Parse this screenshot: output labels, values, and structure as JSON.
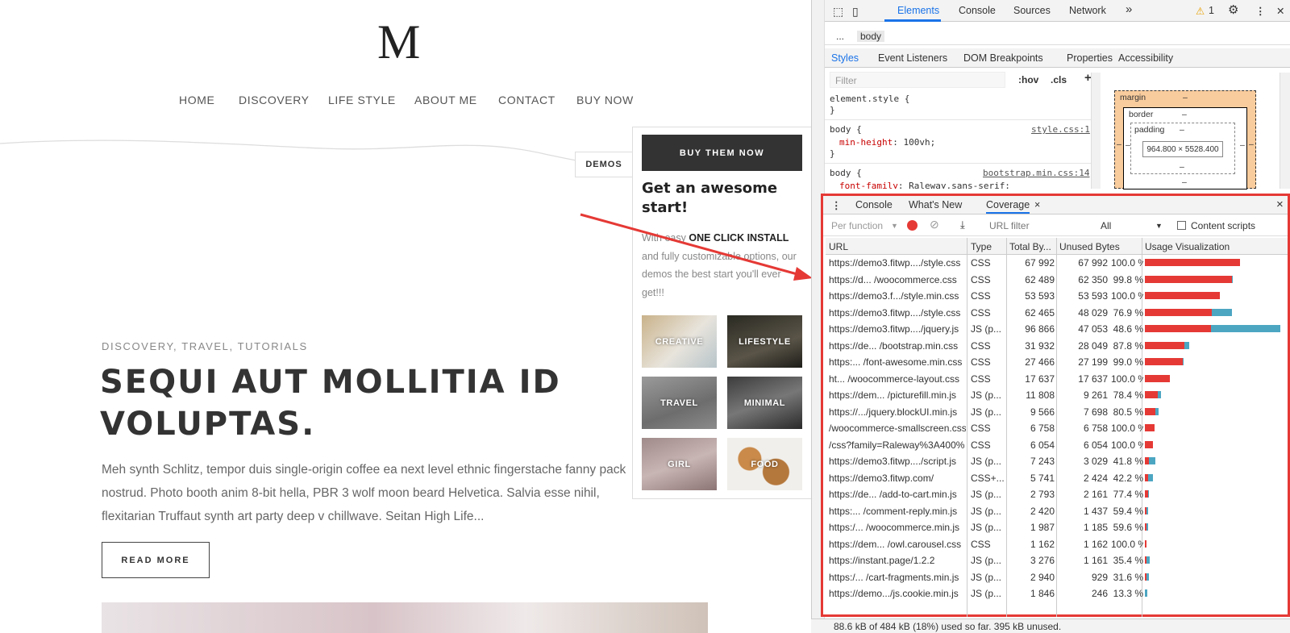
{
  "site": {
    "logo": "M",
    "nav": [
      "HOME",
      "DISCOVERY",
      "LIFE STYLE",
      "ABOUT ME",
      "CONTACT",
      "BUY NOW"
    ],
    "demos_tab": "DEMOS",
    "post": {
      "categories": "DISCOVERY, TRAVEL, TUTORIALS",
      "title": "SEQUI AUT MOLLITIA ID VOLUPTAS.",
      "excerpt": "Meh synth Schlitz, tempor duis single-origin coffee ea next level ethnic fingerstache fanny pack nostrud. Photo booth anim 8-bit hella, PBR 3 wolf moon beard Helvetica. Salvia esse nihil, flexitarian Truffaut synth art party deep v chillwave. Seitan High Life...",
      "read_more": "READ MORE"
    },
    "demos_panel": {
      "buy_button": "BUY THEM NOW",
      "heading": "Get an awesome start!",
      "text_before": "With easy ",
      "text_bold": "ONE CLICK INSTALL",
      "text_after": " and fully customizable options, our demos the best start you'll ever get!!!",
      "tiles": [
        "CREATIVE",
        "LIFESTYLE",
        "TRAVEL",
        "MINIMAL",
        "GIRL",
        "FOOD"
      ]
    }
  },
  "devtools": {
    "top_tabs": [
      "Elements",
      "Console",
      "Sources",
      "Network"
    ],
    "more_tabs": "»",
    "warnings": "1",
    "breadcrumb": [
      "...",
      "body"
    ],
    "sub_tabs": [
      "Styles",
      "Event Listeners",
      "DOM Breakpoints",
      "Properties",
      "Accessibility"
    ],
    "filter_placeholder": "Filter",
    "hov": ":hov",
    "cls": ".cls",
    "plus": "+",
    "styles": {
      "element_style": "element.style {",
      "close": "}",
      "rule1_selector": "body {",
      "rule1_source": "style.css:1",
      "rule1_prop": "min-height",
      "rule1_value": ": 100vh;",
      "rule2_selector": "body {",
      "rule2_source": "bootstrap.min.css:14",
      "rule2_prop": "font-family",
      "rule2_value": ": Raleway,sans-serif;"
    },
    "box_model": {
      "margin": "margin",
      "border": "border",
      "padding": "padding",
      "dash": "–",
      "content": "964.800 × 5528.400"
    },
    "drawer_tabs": [
      "Console",
      "What's New",
      "Coverage"
    ],
    "close": "×",
    "coverage_toolbar": {
      "per_function": "Per function",
      "url_filter": "URL filter",
      "type_select": "All",
      "content_scripts": "Content scripts"
    },
    "columns": [
      "URL",
      "Type",
      "Total By...",
      "Unused Bytes",
      "Usage Visualization"
    ],
    "rows": [
      {
        "url": "https://demo3.fitwp..../style.css",
        "type": "CSS",
        "total": "67 992",
        "unused": "67 992",
        "pct": "100.0 %",
        "unused_frac": 1.0,
        "total_frac": 0.703
      },
      {
        "url": "https://d...  /woocommerce.css",
        "type": "CSS",
        "total": "62 489",
        "unused": "62 350",
        "pct": "99.8 %",
        "unused_frac": 0.998,
        "total_frac": 0.645
      },
      {
        "url": "https://demo3.f.../style.min.css",
        "type": "CSS",
        "total": "53 593",
        "unused": "53 593",
        "pct": "100.0 %",
        "unused_frac": 1.0,
        "total_frac": 0.553
      },
      {
        "url": "https://demo3.fitwp..../style.css",
        "type": "CSS",
        "total": "62 465",
        "unused": "48 029",
        "pct": "76.9 %",
        "unused_frac": 0.769,
        "total_frac": 0.645
      },
      {
        "url": "https://demo3.fitwp..../jquery.js",
        "type": "JS (p...",
        "total": "96 866",
        "unused": "47 053",
        "pct": "48.6 %",
        "unused_frac": 0.486,
        "total_frac": 1.0
      },
      {
        "url": "https://de... /bootstrap.min.css",
        "type": "CSS",
        "total": "31 932",
        "unused": "28 049",
        "pct": "87.8 %",
        "unused_frac": 0.878,
        "total_frac": 0.33
      },
      {
        "url": "https:... /font-awesome.min.css",
        "type": "CSS",
        "total": "27 466",
        "unused": "27 199",
        "pct": "99.0 %",
        "unused_frac": 0.99,
        "total_frac": 0.284
      },
      {
        "url": "ht... /woocommerce-layout.css",
        "type": "CSS",
        "total": "17 637",
        "unused": "17 637",
        "pct": "100.0 %",
        "unused_frac": 1.0,
        "total_frac": 0.182
      },
      {
        "url": "https://dem... /picturefill.min.js",
        "type": "JS (p...",
        "total": "11 808",
        "unused": "9 261",
        "pct": "78.4 %",
        "unused_frac": 0.784,
        "total_frac": 0.122
      },
      {
        "url": "https://.../jquery.blockUI.min.js",
        "type": "JS (p...",
        "total": "9 566",
        "unused": "7 698",
        "pct": "80.5 %",
        "unused_frac": 0.805,
        "total_frac": 0.099
      },
      {
        "url": "/woocommerce-smallscreen.css",
        "type": "CSS",
        "total": "6 758",
        "unused": "6 758",
        "pct": "100.0 %",
        "unused_frac": 1.0,
        "total_frac": 0.07
      },
      {
        "url": "/css?family=Raleway%3A400%",
        "type": "CSS",
        "total": "6 054",
        "unused": "6 054",
        "pct": "100.0 %",
        "unused_frac": 1.0,
        "total_frac": 0.062
      },
      {
        "url": "https://demo3.fitwp..../script.js",
        "type": "JS (p...",
        "total": "7 243",
        "unused": "3 029",
        "pct": "41.8 %",
        "unused_frac": 0.418,
        "total_frac": 0.075
      },
      {
        "url": "https://demo3.fitwp.com/",
        "type": "CSS+...",
        "total": "5 741",
        "unused": "2 424",
        "pct": "42.2 %",
        "unused_frac": 0.422,
        "total_frac": 0.059
      },
      {
        "url": "https://de... /add-to-cart.min.js",
        "type": "JS (p...",
        "total": "2 793",
        "unused": "2 161",
        "pct": "77.4 %",
        "unused_frac": 0.774,
        "total_frac": 0.029
      },
      {
        "url": "https:... /comment-reply.min.js",
        "type": "JS (p...",
        "total": "2 420",
        "unused": "1 437",
        "pct": "59.4 %",
        "unused_frac": 0.594,
        "total_frac": 0.025
      },
      {
        "url": "https:/... /woocommerce.min.js",
        "type": "JS (p...",
        "total": "1 987",
        "unused": "1 185",
        "pct": "59.6 %",
        "unused_frac": 0.596,
        "total_frac": 0.021
      },
      {
        "url": "https://dem... /owl.carousel.css",
        "type": "CSS",
        "total": "1 162",
        "unused": "1 162",
        "pct": "100.0 %",
        "unused_frac": 1.0,
        "total_frac": 0.012
      },
      {
        "url": "https://instant.page/1.2.2",
        "type": "JS (p...",
        "total": "3 276",
        "unused": "1 161",
        "pct": "35.4 %",
        "unused_frac": 0.354,
        "total_frac": 0.034
      },
      {
        "url": "https:/... /cart-fragments.min.js",
        "type": "JS (p...",
        "total": "2 940",
        "unused": "929",
        "pct": "31.6 %",
        "unused_frac": 0.316,
        "total_frac": 0.03
      },
      {
        "url": "https://demo.../js.cookie.min.js",
        "type": "JS (p...",
        "total": "1 846",
        "unused": "246",
        "pct": "13.3 %",
        "unused_frac": 0.133,
        "total_frac": 0.019
      }
    ],
    "status": "88.6 kB of 484 kB (18%) used so far. 395 kB unused.",
    "colors": {
      "unused": "#e53935",
      "used": "#4ca6c2",
      "highlight": "#e53935",
      "accent": "#1a73e8"
    }
  }
}
